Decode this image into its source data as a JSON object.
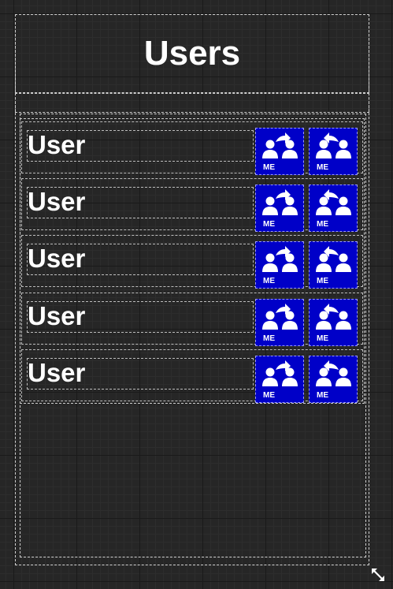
{
  "panel": {
    "title": "Users"
  },
  "users": [
    {
      "label": "User",
      "actions": [
        {
          "icon": "transfer-to-user-icon",
          "badge": "ME"
        },
        {
          "icon": "transfer-from-user-icon",
          "badge": "ME"
        }
      ]
    },
    {
      "label": "User",
      "actions": [
        {
          "icon": "transfer-to-user-icon",
          "badge": "ME"
        },
        {
          "icon": "transfer-from-user-icon",
          "badge": "ME"
        }
      ]
    },
    {
      "label": "User",
      "actions": [
        {
          "icon": "transfer-to-user-icon",
          "badge": "ME"
        },
        {
          "icon": "transfer-from-user-icon",
          "badge": "ME"
        }
      ]
    },
    {
      "label": "User",
      "actions": [
        {
          "icon": "transfer-to-user-icon",
          "badge": "ME"
        },
        {
          "icon": "transfer-from-user-icon",
          "badge": "ME"
        }
      ]
    },
    {
      "label": "User",
      "actions": [
        {
          "icon": "transfer-to-user-icon",
          "badge": "ME"
        },
        {
          "icon": "transfer-from-user-icon",
          "badge": "ME"
        }
      ]
    }
  ],
  "colors": {
    "background": "#262626",
    "button": "#0000c8",
    "text": "#ffffff"
  }
}
